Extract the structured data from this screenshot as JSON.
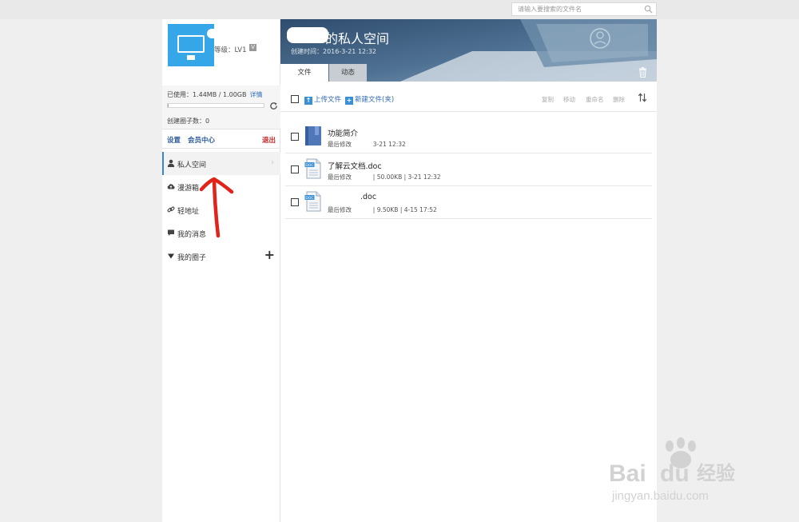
{
  "search": {
    "placeholder": "请输入要搜索的文件名"
  },
  "profile": {
    "level_label": "等级：LV1",
    "vip_badge": "V"
  },
  "quota": {
    "used_label": "已使用：1.44MB / 1.00GB",
    "details_label": "详情",
    "usage_percent": 0.1,
    "circles_label": "创建圈子数：0"
  },
  "links": {
    "settings": "设置",
    "member_center": "会员中心",
    "logout": "退出"
  },
  "nav": [
    {
      "label": "私人空间",
      "icon": "user-icon",
      "active": true
    },
    {
      "label": "漫游箱",
      "icon": "cloud-icon"
    },
    {
      "label": "轻地址",
      "icon": "link-icon"
    },
    {
      "label": "我的消息",
      "icon": "message-icon"
    },
    {
      "label": "我的圈子",
      "icon": "triangle-down-icon"
    }
  ],
  "banner": {
    "title": "的私人空间",
    "created": "创建时间：2016-3-21 12:32"
  },
  "tabs": [
    {
      "label": "文件"
    },
    {
      "label": "动态"
    }
  ],
  "toolbar": {
    "upload": "上传文件",
    "new_folder": "新建文件(夹)",
    "copy": "复制",
    "move": "移动",
    "rename": "重命名",
    "delete": "删除"
  },
  "files": [
    {
      "name": "功能简介",
      "meta_prefix": "最后修改",
      "meta": "3-21 12:32",
      "type": "folder"
    },
    {
      "name": "了解云文档.doc",
      "meta_prefix": "最后修改",
      "meta": "| 50.00KB | 3-21 12:32",
      "type": "doc"
    },
    {
      "name": ".doc",
      "meta_prefix": "最后修改",
      "meta": "| 9.50KB | 4-15 17:52",
      "type": "doc"
    }
  ],
  "watermark": {
    "brand": "Bai",
    "brand2": "du",
    "cn": "经验",
    "url": "jingyan.baidu.com"
  },
  "colors": {
    "accent_blue": "#2e6ab8",
    "logout_red": "#c62828",
    "avatar_blue": "#35a6e8",
    "arrow_red": "#e0241b"
  }
}
